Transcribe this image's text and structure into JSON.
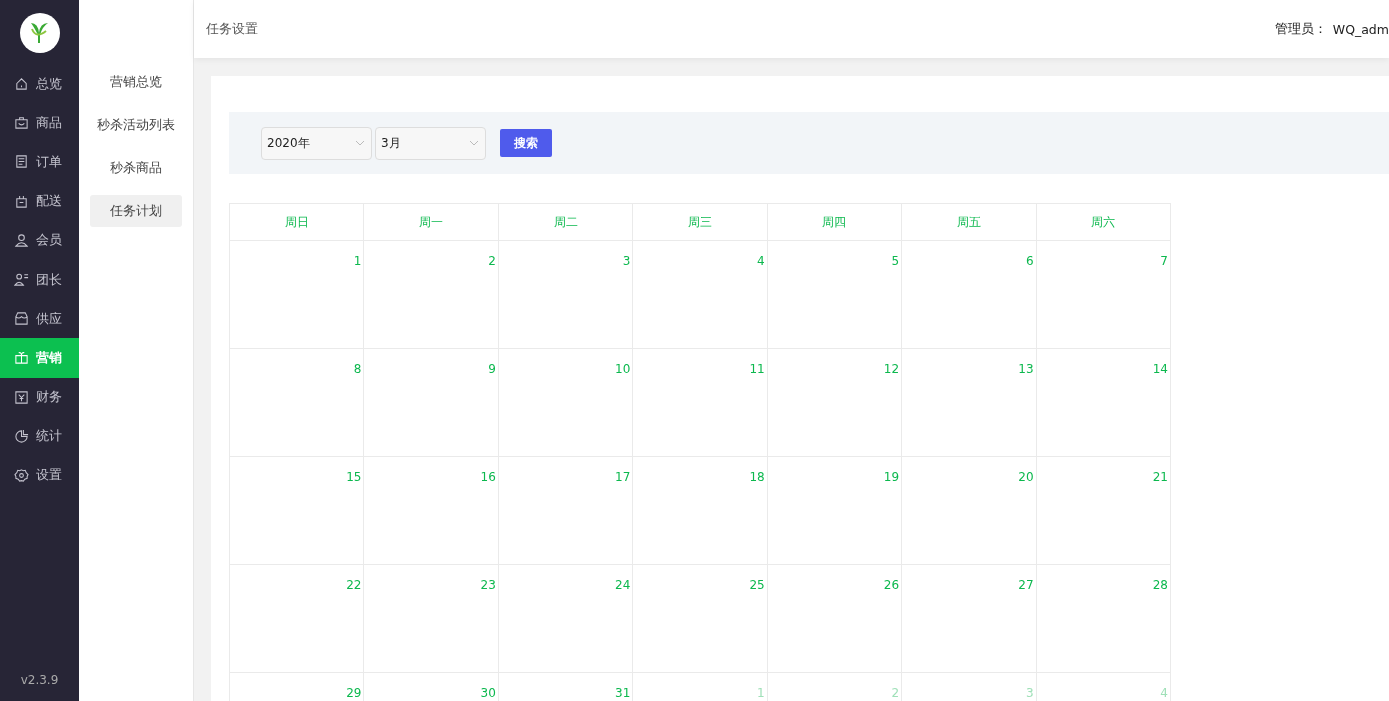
{
  "sidebar": {
    "items": [
      {
        "label": "总览",
        "selected": false
      },
      {
        "label": "商品",
        "selected": false
      },
      {
        "label": "订单",
        "selected": false
      },
      {
        "label": "配送",
        "selected": false
      },
      {
        "label": "会员",
        "selected": false
      },
      {
        "label": "团长",
        "selected": false
      },
      {
        "label": "供应",
        "selected": false
      },
      {
        "label": "营销",
        "selected": true
      },
      {
        "label": "财务",
        "selected": false
      },
      {
        "label": "统计",
        "selected": false
      },
      {
        "label": "设置",
        "selected": false
      }
    ],
    "version": "v2.3.9"
  },
  "submenu": {
    "items": [
      {
        "label": "营销总览",
        "selected": false
      },
      {
        "label": "秒杀活动列表",
        "selected": false
      },
      {
        "label": "秒杀商品",
        "selected": false
      },
      {
        "label": "任务计划",
        "selected": true
      }
    ]
  },
  "header": {
    "title": "任务设置",
    "admin_label": "管理员：",
    "admin_name": "WQ_adm"
  },
  "filter": {
    "year": "2020年",
    "month": "3月",
    "search_button": "搜索"
  },
  "calendar": {
    "weekdays": [
      "周日",
      "周一",
      "周二",
      "周三",
      "周四",
      "周五",
      "周六"
    ],
    "days": [
      {
        "label": "1",
        "current": true
      },
      {
        "label": "2",
        "current": true
      },
      {
        "label": "3",
        "current": true
      },
      {
        "label": "4",
        "current": true
      },
      {
        "label": "5",
        "current": true
      },
      {
        "label": "6",
        "current": true
      },
      {
        "label": "7",
        "current": true
      },
      {
        "label": "8",
        "current": true
      },
      {
        "label": "9",
        "current": true
      },
      {
        "label": "10",
        "current": true
      },
      {
        "label": "11",
        "current": true
      },
      {
        "label": "12",
        "current": true
      },
      {
        "label": "13",
        "current": true
      },
      {
        "label": "14",
        "current": true
      },
      {
        "label": "15",
        "current": true
      },
      {
        "label": "16",
        "current": true
      },
      {
        "label": "17",
        "current": true
      },
      {
        "label": "18",
        "current": true
      },
      {
        "label": "19",
        "current": true
      },
      {
        "label": "20",
        "current": true
      },
      {
        "label": "21",
        "current": true
      },
      {
        "label": "22",
        "current": true
      },
      {
        "label": "23",
        "current": true
      },
      {
        "label": "24",
        "current": true
      },
      {
        "label": "25",
        "current": true
      },
      {
        "label": "26",
        "current": true
      },
      {
        "label": "27",
        "current": true
      },
      {
        "label": "28",
        "current": true
      },
      {
        "label": "29",
        "current": true
      },
      {
        "label": "30",
        "current": true
      },
      {
        "label": "31",
        "current": true
      },
      {
        "label": "1",
        "current": false
      },
      {
        "label": "2",
        "current": false
      },
      {
        "label": "3",
        "current": false
      },
      {
        "label": "4",
        "current": false
      }
    ]
  }
}
